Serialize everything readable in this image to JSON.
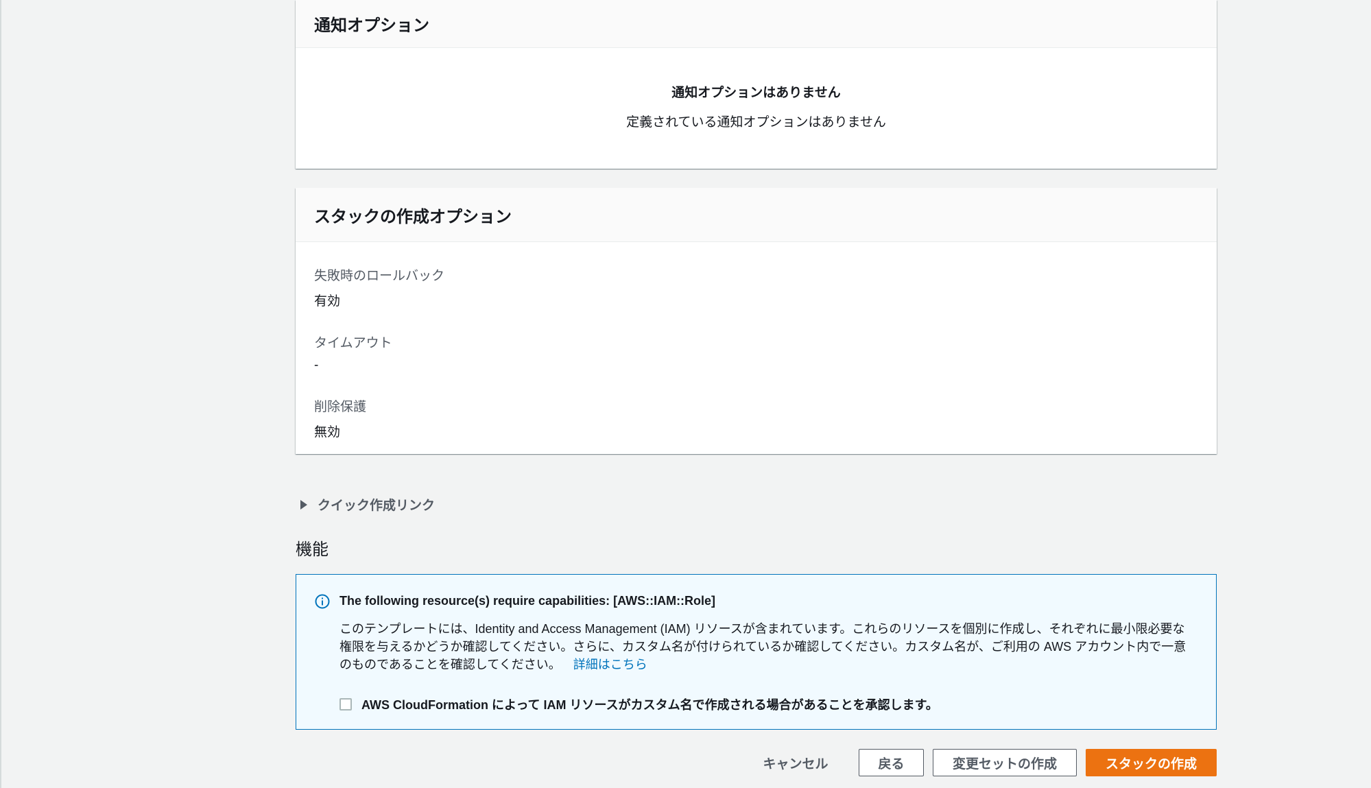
{
  "notification_panel": {
    "title": "通知オプション",
    "empty_title": "通知オプションはありません",
    "empty_subtitle": "定義されている通知オプションはありません"
  },
  "stack_options_panel": {
    "title": "スタックの作成オプション",
    "fields": [
      {
        "label": "失敗時のロールバック",
        "value": "有効"
      },
      {
        "label": "タイムアウト",
        "value": "-"
      },
      {
        "label": "削除保護",
        "value": "無効"
      }
    ]
  },
  "quick_create": {
    "label": "クイック作成リンク"
  },
  "capabilities": {
    "heading": "機能",
    "alert_title": "The following resource(s) require capabilities: [AWS::IAM::Role]",
    "alert_body": "このテンプレートには、Identity and Access Management (IAM) リソースが含まれています。これらのリソースを個別に作成し、それぞれに最小限必要な権限を与えるかどうか確認してください。さらに、カスタム名が付けられているか確認してください。カスタム名が、ご利用の AWS アカウント内で一意のものであることを確認してください。",
    "learn_more": "詳細はこちら",
    "ack_label": "AWS CloudFormation によって IAM リソースがカスタム名で作成される場合があることを承認します。",
    "info_icon": "info-circle-icon",
    "accent_color": "#0073bb"
  },
  "actions": {
    "cancel": "キャンセル",
    "back": "戻る",
    "create_change_set": "変更セットの作成",
    "create_stack": "スタックの作成",
    "primary_color": "#ec7211"
  }
}
